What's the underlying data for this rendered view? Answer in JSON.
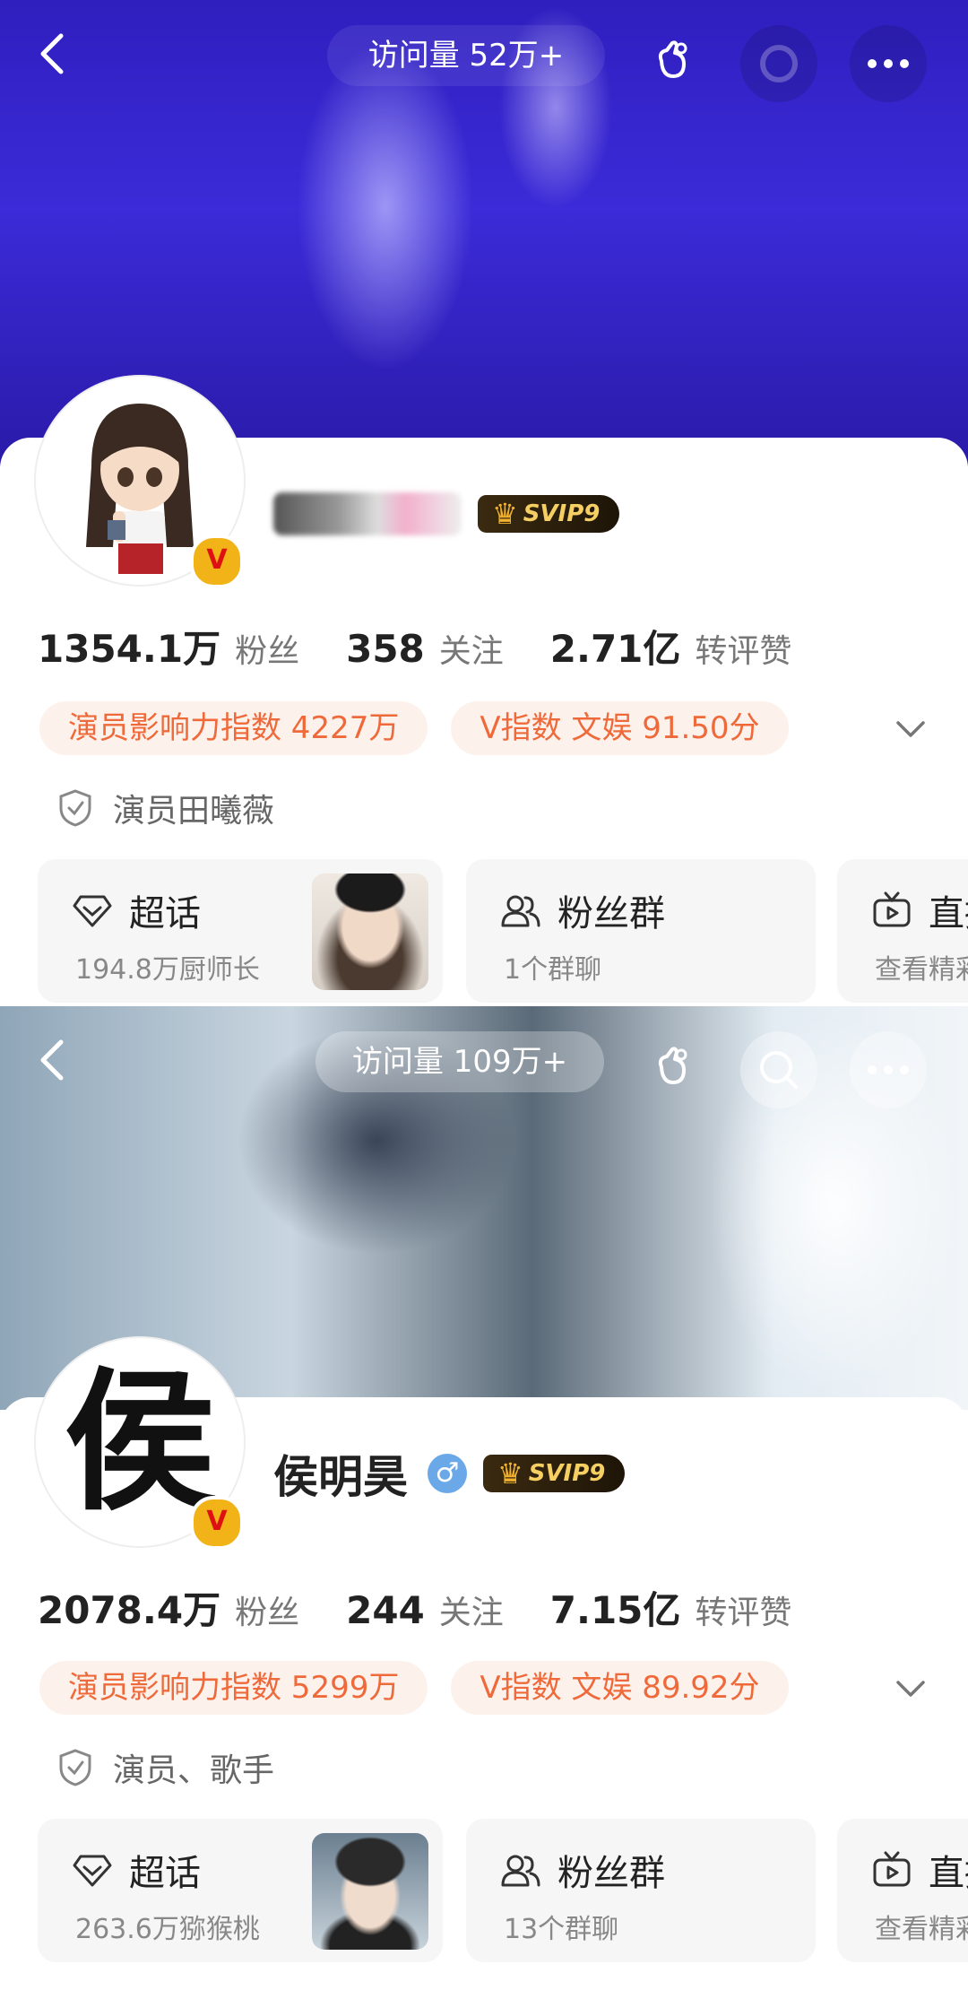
{
  "profiles": [
    {
      "header": {
        "visits": "访问量 52万+"
      },
      "user": {
        "name": "",
        "svip": "SVIP9",
        "badge": "V",
        "avatar_char": ""
      },
      "stats": [
        {
          "value": "1354.1万",
          "label": "粉丝"
        },
        {
          "value": "358",
          "label": "关注"
        },
        {
          "value": "2.71亿",
          "label": "转评赞"
        }
      ],
      "tags": [
        "演员影响力指数 4227万",
        "V指数 文娱 91.50分"
      ],
      "verification": "演员田曦薇",
      "features": {
        "chaohua": {
          "title": "超话",
          "sub": "194.8万厨师长"
        },
        "fans": {
          "title": "粉丝群",
          "sub": "1个群聊"
        },
        "live": {
          "title": "直播",
          "sub": "查看精彩"
        }
      }
    },
    {
      "header": {
        "visits": "访问量 109万+"
      },
      "user": {
        "name": "侯明昊",
        "gender": "♂",
        "svip": "SVIP9",
        "badge": "V",
        "avatar_char": "侯"
      },
      "stats": [
        {
          "value": "2078.4万",
          "label": "粉丝"
        },
        {
          "value": "244",
          "label": "关注"
        },
        {
          "value": "7.15亿",
          "label": "转评赞"
        }
      ],
      "tags": [
        "演员影响力指数 5299万",
        "V指数 文娱 89.92分"
      ],
      "verification": "演员、歌手",
      "features": {
        "chaohua": {
          "title": "超话",
          "sub": "263.6万猕猴桃"
        },
        "fans": {
          "title": "粉丝群",
          "sub": "13个群聊"
        },
        "live": {
          "title": "直播",
          "sub": "查看精彩"
        }
      }
    }
  ],
  "colors": {
    "tag_text": "#ef6a3a",
    "tag_bg": "#fdf1ec",
    "badge": "#f2b318",
    "gender": "#6aa8e8"
  },
  "icons": [
    "back-arrow-icon",
    "gift-hand-icon",
    "search-icon",
    "more-icon",
    "chevron-down-icon",
    "shield-check-icon",
    "diamond-icon",
    "people-icon",
    "tv-icon"
  ]
}
